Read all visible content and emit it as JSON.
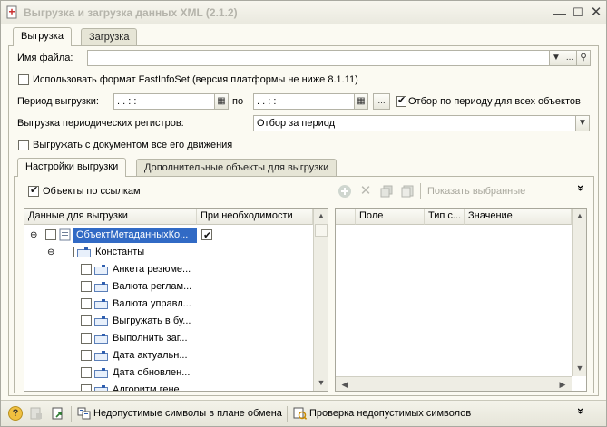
{
  "window": {
    "title": "Выгрузка и загрузка данных XML (2.1.2)"
  },
  "outer_tabs": [
    {
      "label": "Выгрузка",
      "active": true
    },
    {
      "label": "Загрузка",
      "active": false
    }
  ],
  "form": {
    "file_label": "Имя файла:",
    "file_value": "",
    "fastinfoset_label": "Использовать формат FastInfoSet (версия платформы не ниже 8.1.11)",
    "period_label": "Период выгрузки:",
    "period_from": " .  .     :  :",
    "period_to_label": "по",
    "period_to": " .  .     :  :",
    "ellipsis": "...",
    "period_filter_label": "Отбор по периоду для всех объектов",
    "periodic_label": "Выгрузка периодических регистров:",
    "periodic_value": "Отбор за период",
    "with_movements_label": "Выгружать с документом все его движения"
  },
  "inner_tabs": [
    {
      "label": "Настройки выгрузки",
      "active": true
    },
    {
      "label": "Дополнительные объекты для выгрузки",
      "active": false
    }
  ],
  "settings": {
    "by_refs_label": "Объекты по ссылкам",
    "show_selected_label": "Показать выбранные",
    "more": "»"
  },
  "left_grid": {
    "columns": [
      "Данные для выгрузки",
      "При необходимости"
    ],
    "root_label": "ОбъектМетаданныхКо...",
    "constants_label": "Константы",
    "items": [
      "Анкета резюме...",
      "Валюта реглам...",
      "Валюта управл...",
      "Выгружать в бу...",
      "Выполнить заг...",
      "Дата актуальн...",
      "Дата обновлен...",
      "Алгоритм гене..."
    ]
  },
  "right_grid": {
    "columns": [
      "",
      "Поле",
      "Тип с...",
      "Значение"
    ]
  },
  "statusbar": {
    "invalid_chars_label": "Недопустимые символы в плане обмена",
    "check_invalid_label": "Проверка недопустимых символов"
  },
  "colors": {
    "accent_selection": "#316ac5",
    "title_text": "#b5b4ab"
  }
}
